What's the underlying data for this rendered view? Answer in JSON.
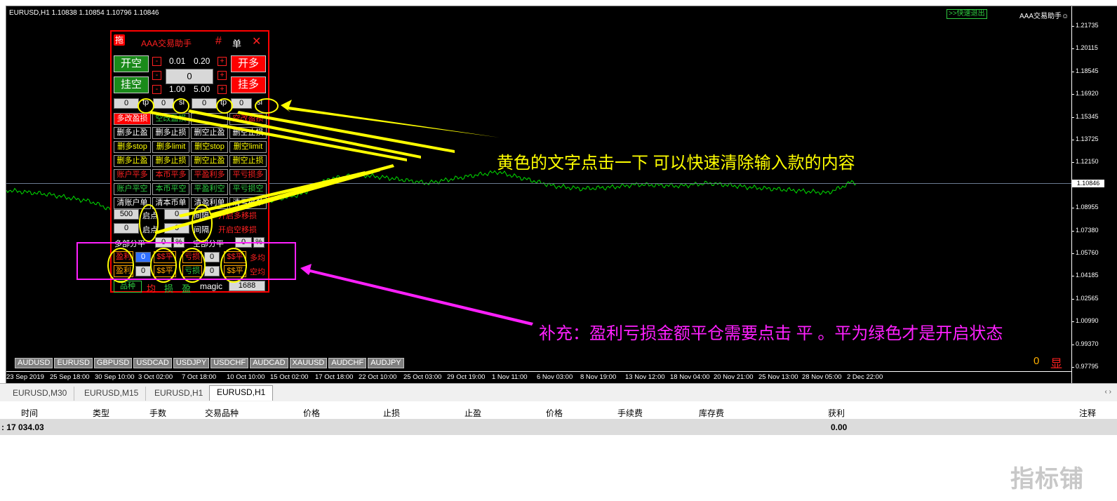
{
  "chart": {
    "symbol_info": "EURUSD,H1  1.10838 1.10854 1.10796 1.10846",
    "quick_exit": ">>快速退出",
    "brand": "AAA交易助手☺",
    "last_price": "1.10846",
    "y_ticks": [
      "1.21735",
      "1.20115",
      "1.18545",
      "1.16920",
      "1.15345",
      "1.13725",
      "1.12150",
      "1.10530",
      "1.08955",
      "1.07380",
      "1.05760",
      "1.04185",
      "1.02565",
      "1.00990",
      "0.99370",
      "0.97795"
    ],
    "x_ticks": [
      "23 Sep 2019",
      "25 Sep 18:00",
      "30 Sep 10:00",
      "3 Oct 02:00",
      "7 Oct 18:00",
      "10 Oct 10:00",
      "15 Oct 02:00",
      "17 Oct 18:00",
      "22 Oct 10:00",
      "25 Oct 03:00",
      "29 Oct 19:00",
      "1 Nov 11:00",
      "6 Nov 03:00",
      "8 Nov 19:00",
      "13 Nov 12:00",
      "18 Nov 04:00",
      "20 Nov 21:00",
      "25 Nov 13:00",
      "28 Nov 05:00",
      "2 Dec 22:00"
    ],
    "symbols": [
      "AUDUSD",
      "EURUSD",
      "GBPUSD",
      "USDCAD",
      "USDJPY",
      "USDCHF",
      "AUDCAD",
      "XAUUSD",
      "AUDCHF",
      "AUDJPY"
    ],
    "zero_value": "0",
    "display_label": "显",
    "line_color": "#00e000"
  },
  "panel": {
    "drag_icon": "拖",
    "title": "AAA交易助手",
    "hash": "#",
    "single": "单",
    "close": "✕",
    "open_short": "开空",
    "open_long": "开多",
    "pending_short": "挂空",
    "pending_long": "挂多",
    "minus": "-",
    "plus": "+",
    "lot_small": "0.01",
    "lot_large": "0.20",
    "lot_value": "0",
    "step_small": "1.00",
    "step_large": "5.00",
    "tp": "tp",
    "sl": "sl",
    "tpsl_values": [
      "0",
      "0",
      "0",
      "0"
    ],
    "rows": [
      [
        "多改盈损",
        "空改盈损",
        "",
        "空改盈损"
      ],
      [
        "删多止盈",
        "删多止损",
        "删空止盈",
        "删空止损"
      ],
      [
        "删多stop",
        "删多limit",
        "删空stop",
        "删空limit"
      ],
      [
        "删多止盈",
        "删多止损",
        "删空止盈",
        "删空止损"
      ],
      [
        "账户平多",
        "本币平多",
        "平盈利多",
        "平亏损多"
      ],
      [
        "账户平空",
        "本币平空",
        "平盈利空",
        "平亏损空"
      ],
      [
        "清账户单",
        "清本币单",
        "清盈利单",
        "清亏损单"
      ]
    ],
    "start_point": "启点",
    "interval": "间隔",
    "trail_long": "开启多移损",
    "trail_short": "开启空移损",
    "val_500": "500",
    "val_0": "0",
    "long_partial": "多部分平",
    "short_partial": "空部分平",
    "percent": "%",
    "profit": "盈利",
    "loss": "亏损",
    "close_money": "$$平",
    "long_avg": "多均",
    "short_avg": "空均",
    "symbol_btn": "品种",
    "loss_c": "均",
    "loss_s": "损",
    "win_s": "盈",
    "magic_label": "magic",
    "magic_value": "1688"
  },
  "annotations": {
    "yellow": "黄色的文字点击一下    可以快速清除输入款的内容",
    "magenta": "补充：盈利亏损金额平仓需要点击 平    。平为绿色才是开启状态"
  },
  "tabs": [
    "EURUSD,M30",
    "EURUSD,M15",
    "EURUSD,H1",
    "EURUSD,H1"
  ],
  "active_tab": 3,
  "scroll_arrows": "‹  ›",
  "table": {
    "headers": [
      "时间",
      "类型",
      "手数",
      "交易品种",
      "价格",
      "止损",
      "止盈",
      "价格",
      "手续费",
      "库存费",
      "获利",
      "注释"
    ],
    "balance": ": 17 034.03",
    "profit": "0.00"
  },
  "watermark": "指标铺"
}
